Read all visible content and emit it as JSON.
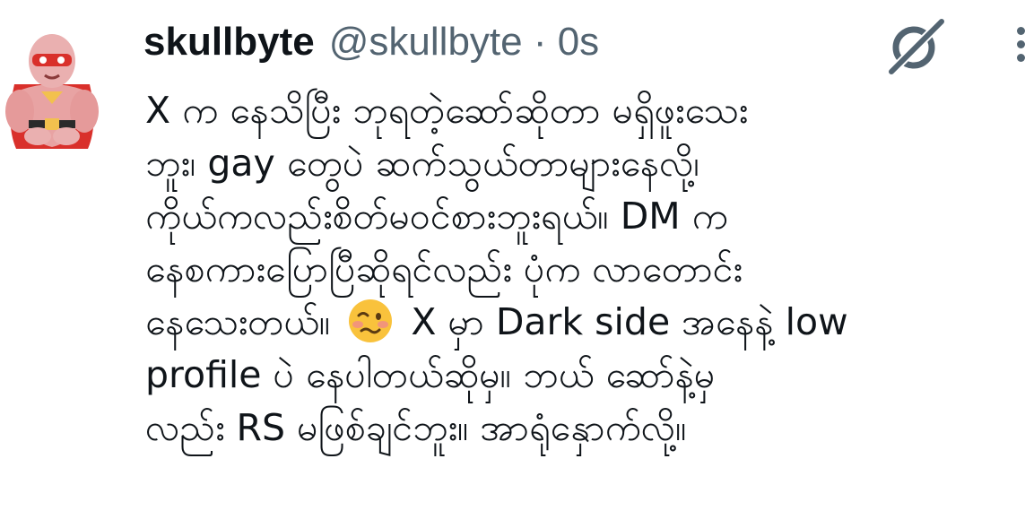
{
  "tweet": {
    "display_name": "skullbyte",
    "handle_time": "@skullbyte · 0s",
    "lines": [
      "X က နေသိပြီး ဘုရတဲ့ဆော်ဆိုတာ မရှိဖူးသေး",
      "ဘူး၊ gay တွေပဲ ဆက်သွယ်တာများနေလို့၊",
      "ကိုယ်ကလည်းစိတ်မဝင်စားဘူးရယ်။ DM က",
      "နေစကားပြောပြီဆိုရင်လည်း ပုံက လာတောင်း",
      "နေသေးတယ်။",
      "X မှာ Dark side အနေနဲ့ low",
      "profile ပဲ နေပါတယ်ဆိုမှ။ ဘယ် ဆော်နဲ့မှ",
      "လည်း RS မဖြစ်ချင်ဘူး။ အာရုံနှောက်လို့။"
    ]
  },
  "icons": {
    "avatar": "avatar-icon",
    "grok": "grok-icon",
    "more": "more-options-icon",
    "emoji": "woozy-face-emoji"
  },
  "colors": {
    "text": "#0f1419",
    "secondary": "#536471",
    "avatar_pink": "#e8a3a3",
    "avatar_red": "#d9302b",
    "emoji_yellow": "#f9c23c"
  }
}
